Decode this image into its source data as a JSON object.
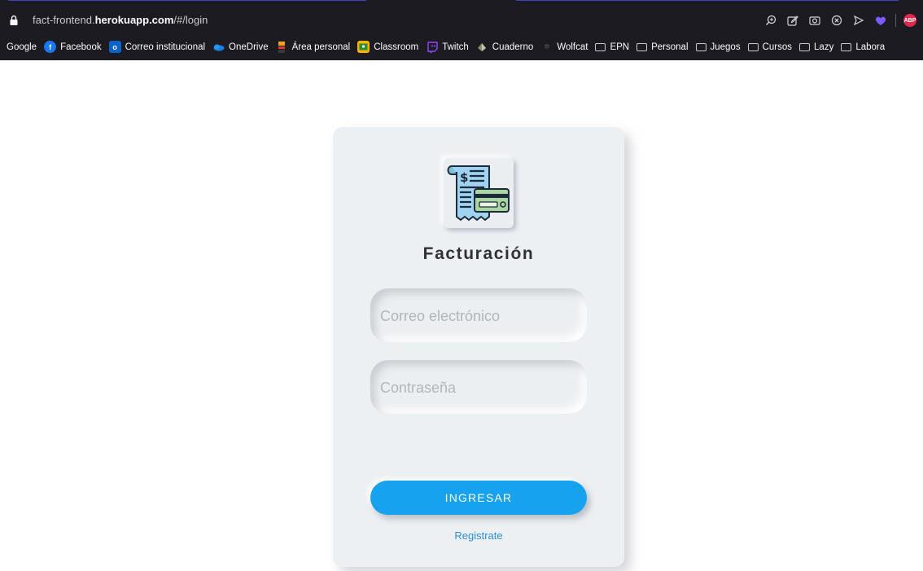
{
  "browser": {
    "url_prefix": "fact-frontend.",
    "url_domain": "herokuapp.com",
    "url_path": "/#/login",
    "abp_label": "ABP",
    "toolbar_icons": [
      "zoom-icon",
      "edit-icon",
      "screenshot-icon",
      "close-circle-icon",
      "send-icon",
      "heart-icon",
      "adblock-icon"
    ]
  },
  "bookmarks": [
    {
      "label": "Google",
      "icon": "none"
    },
    {
      "label": "Facebook",
      "icon": "facebook-icon",
      "color": "#1877f2"
    },
    {
      "label": "Correo institucional",
      "icon": "outlook-icon",
      "color": "#0a64c8"
    },
    {
      "label": "OneDrive",
      "icon": "onedrive-icon",
      "color": "#1a7fe0"
    },
    {
      "label": "Área personal",
      "icon": "moodle-icon",
      "color": "#f1a31b"
    },
    {
      "label": "Classroom",
      "icon": "classroom-icon",
      "color": "#f6b300"
    },
    {
      "label": "Twitch",
      "icon": "twitch-icon",
      "color": "#9146ff"
    },
    {
      "label": "Cuaderno",
      "icon": "notebook-icon",
      "color": "#8a8f6a"
    },
    {
      "label": "Wolfcat",
      "icon": "wolfcat-icon",
      "color": "#444"
    },
    {
      "label": "EPN",
      "icon": "folder-icon"
    },
    {
      "label": "Personal",
      "icon": "folder-icon"
    },
    {
      "label": "Juegos",
      "icon": "folder-icon"
    },
    {
      "label": "Cursos",
      "icon": "folder-icon"
    },
    {
      "label": "Lazy",
      "icon": "folder-icon"
    },
    {
      "label": "Labora",
      "icon": "folder-icon"
    }
  ],
  "login": {
    "title": "Facturación",
    "email_placeholder": "Correo electrónico",
    "email_value": "",
    "password_placeholder": "Contraseña",
    "password_value": "",
    "submit_label": "INGRESAR",
    "register_label": "Registrate",
    "accent_color": "#16a2ee"
  }
}
